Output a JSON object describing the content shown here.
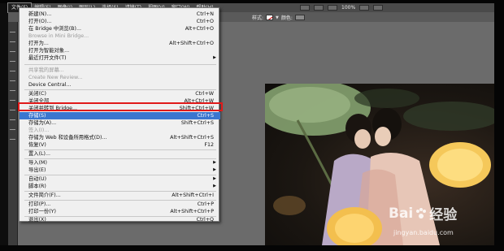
{
  "menubar": {
    "items": [
      {
        "label": "文件(F)"
      },
      {
        "label": "编辑(E)"
      },
      {
        "label": "图像(I)"
      },
      {
        "label": "图层(L)"
      },
      {
        "label": "选择(S)"
      },
      {
        "label": "滤镜(T)"
      },
      {
        "label": "视图(V)"
      },
      {
        "label": "窗口(W)"
      },
      {
        "label": "帮助(H)"
      }
    ]
  },
  "topbar": {
    "zoom": "100%"
  },
  "options": {
    "style_label": "样式:",
    "color_label": "颜色:"
  },
  "file_menu": {
    "items": [
      {
        "label": "新建(N)...",
        "shortcut": "Ctrl+N"
      },
      {
        "label": "打开(O)...",
        "shortcut": "Ctrl+O"
      },
      {
        "label": "在 Bridge 中浏览(B)...",
        "shortcut": "Alt+Ctrl+O"
      },
      {
        "label": "Browse in Mini Bridge...",
        "shortcut": "",
        "disabled": true
      },
      {
        "label": "打开为...",
        "shortcut": "Alt+Shift+Ctrl+O"
      },
      {
        "label": "打开为智能对象...",
        "shortcut": ""
      },
      {
        "label": "最近打开文件(T)",
        "shortcut": "",
        "submenu": true
      },
      {
        "label": "共享我的屏幕...",
        "shortcut": "",
        "disabled": true
      },
      {
        "label": "Create New Review...",
        "shortcut": "",
        "disabled": true
      },
      {
        "label": "Device Central...",
        "shortcut": ""
      },
      {
        "label": "关闭(C)",
        "shortcut": "Ctrl+W"
      },
      {
        "label": "关闭全部",
        "shortcut": "Alt+Ctrl+W"
      },
      {
        "label": "关闭并转到 Bridge...",
        "shortcut": "Shift+Ctrl+W"
      },
      {
        "label": "存储(S)",
        "shortcut": "Ctrl+S",
        "highlighted": true
      },
      {
        "label": "存储为(A)...",
        "shortcut": "Shift+Ctrl+S"
      },
      {
        "label": "签入(I)...",
        "shortcut": "",
        "disabled": true
      },
      {
        "label": "存储为 Web 和设备所用格式(D)...",
        "shortcut": "Alt+Shift+Ctrl+S"
      },
      {
        "label": "恢复(V)",
        "shortcut": "F12"
      },
      {
        "label": "置入(L)...",
        "shortcut": ""
      },
      {
        "label": "导入(M)",
        "shortcut": "",
        "submenu": true
      },
      {
        "label": "导出(E)",
        "shortcut": "",
        "submenu": true
      },
      {
        "label": "自动(U)",
        "shortcut": "",
        "submenu": true
      },
      {
        "label": "脚本(R)",
        "shortcut": "",
        "submenu": true
      },
      {
        "label": "文件简介(F)...",
        "shortcut": "Alt+Shift+Ctrl+I"
      },
      {
        "label": "打印(P)...",
        "shortcut": "Ctrl+P"
      },
      {
        "label": "打印一份(Y)",
        "shortcut": "Alt+Shift+Ctrl+P"
      },
      {
        "label": "退出(X)",
        "shortcut": "Ctrl+Q"
      }
    ]
  },
  "watermark": {
    "logo_left": "Bai",
    "logo_right": "经验",
    "url": "jingyan.baidu.com"
  },
  "colors": {
    "highlight": "#3b76cf",
    "red_box": "#e01a1a"
  }
}
